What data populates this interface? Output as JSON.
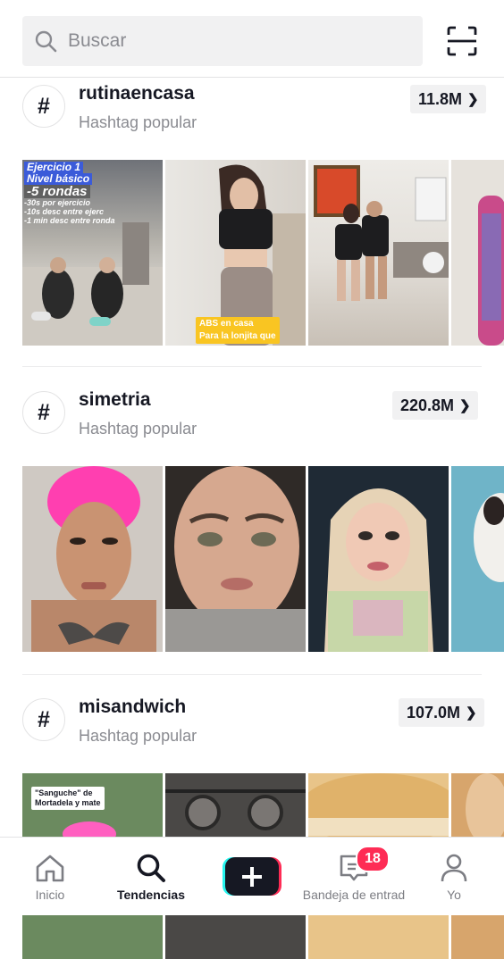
{
  "search": {
    "placeholder": "Buscar"
  },
  "sections": [
    {
      "tag": "rutinaencasa",
      "subtitle": "Hashtag popular",
      "count": "11.8M",
      "thumbs": [
        {
          "captions": [
            "Ejercicio 1",
            "Nivel básico",
            "-5 rondas",
            "-30s por ejercicio",
            "-10s desc entre ejerc",
            "-1 min desc entre ronda"
          ]
        },
        {
          "captions": [
            "ABS en casa",
            "Para la lonjita que"
          ]
        },
        {
          "captions": []
        },
        {
          "captions": []
        }
      ]
    },
    {
      "tag": "simetria",
      "subtitle": "Hashtag popular",
      "count": "220.8M",
      "thumbs": [
        {
          "captions": []
        },
        {
          "captions": []
        },
        {
          "captions": []
        },
        {
          "captions": []
        }
      ]
    },
    {
      "tag": "misandwich",
      "subtitle": "Hashtag popular",
      "count": "107.0M",
      "thumbs": [
        {
          "captions": [
            "\"Sanguche\" de",
            "Mortadela y mate"
          ]
        },
        {
          "captions": []
        },
        {
          "captions": []
        },
        {
          "captions": []
        }
      ]
    }
  ],
  "nav": {
    "home": "Inicio",
    "discover": "Tendencias",
    "inbox": "Bandeja de entrad",
    "inbox_badge": "18",
    "profile": "Yo"
  },
  "colors": {
    "accent": "#fe2c55",
    "cyan": "#25f4ee",
    "text": "#161823",
    "muted": "#8a8b91"
  }
}
